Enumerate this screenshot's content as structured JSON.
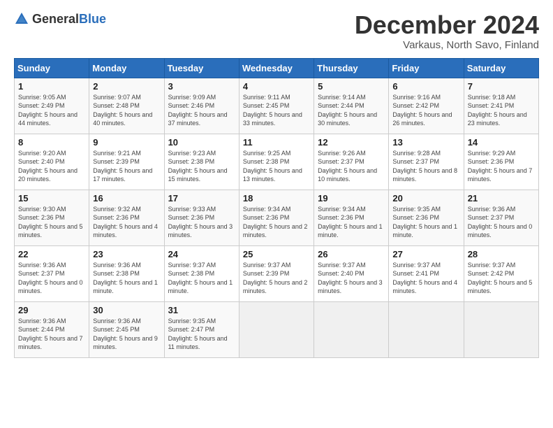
{
  "header": {
    "logo_general": "General",
    "logo_blue": "Blue",
    "title": "December 2024",
    "subtitle": "Varkaus, North Savo, Finland"
  },
  "weekdays": [
    "Sunday",
    "Monday",
    "Tuesday",
    "Wednesday",
    "Thursday",
    "Friday",
    "Saturday"
  ],
  "weeks": [
    [
      {
        "day": "1",
        "sunrise": "9:05 AM",
        "sunset": "2:49 PM",
        "daylight": "5 hours and 44 minutes."
      },
      {
        "day": "2",
        "sunrise": "9:07 AM",
        "sunset": "2:48 PM",
        "daylight": "5 hours and 40 minutes."
      },
      {
        "day": "3",
        "sunrise": "9:09 AM",
        "sunset": "2:46 PM",
        "daylight": "5 hours and 37 minutes."
      },
      {
        "day": "4",
        "sunrise": "9:11 AM",
        "sunset": "2:45 PM",
        "daylight": "5 hours and 33 minutes."
      },
      {
        "day": "5",
        "sunrise": "9:14 AM",
        "sunset": "2:44 PM",
        "daylight": "5 hours and 30 minutes."
      },
      {
        "day": "6",
        "sunrise": "9:16 AM",
        "sunset": "2:42 PM",
        "daylight": "5 hours and 26 minutes."
      },
      {
        "day": "7",
        "sunrise": "9:18 AM",
        "sunset": "2:41 PM",
        "daylight": "5 hours and 23 minutes."
      }
    ],
    [
      {
        "day": "8",
        "sunrise": "9:20 AM",
        "sunset": "2:40 PM",
        "daylight": "5 hours and 20 minutes."
      },
      {
        "day": "9",
        "sunrise": "9:21 AM",
        "sunset": "2:39 PM",
        "daylight": "5 hours and 17 minutes."
      },
      {
        "day": "10",
        "sunrise": "9:23 AM",
        "sunset": "2:38 PM",
        "daylight": "5 hours and 15 minutes."
      },
      {
        "day": "11",
        "sunrise": "9:25 AM",
        "sunset": "2:38 PM",
        "daylight": "5 hours and 13 minutes."
      },
      {
        "day": "12",
        "sunrise": "9:26 AM",
        "sunset": "2:37 PM",
        "daylight": "5 hours and 10 minutes."
      },
      {
        "day": "13",
        "sunrise": "9:28 AM",
        "sunset": "2:37 PM",
        "daylight": "5 hours and 8 minutes."
      },
      {
        "day": "14",
        "sunrise": "9:29 AM",
        "sunset": "2:36 PM",
        "daylight": "5 hours and 7 minutes."
      }
    ],
    [
      {
        "day": "15",
        "sunrise": "9:30 AM",
        "sunset": "2:36 PM",
        "daylight": "5 hours and 5 minutes."
      },
      {
        "day": "16",
        "sunrise": "9:32 AM",
        "sunset": "2:36 PM",
        "daylight": "5 hours and 4 minutes."
      },
      {
        "day": "17",
        "sunrise": "9:33 AM",
        "sunset": "2:36 PM",
        "daylight": "5 hours and 3 minutes."
      },
      {
        "day": "18",
        "sunrise": "9:34 AM",
        "sunset": "2:36 PM",
        "daylight": "5 hours and 2 minutes."
      },
      {
        "day": "19",
        "sunrise": "9:34 AM",
        "sunset": "2:36 PM",
        "daylight": "5 hours and 1 minute."
      },
      {
        "day": "20",
        "sunrise": "9:35 AM",
        "sunset": "2:36 PM",
        "daylight": "5 hours and 1 minute."
      },
      {
        "day": "21",
        "sunrise": "9:36 AM",
        "sunset": "2:37 PM",
        "daylight": "5 hours and 0 minutes."
      }
    ],
    [
      {
        "day": "22",
        "sunrise": "9:36 AM",
        "sunset": "2:37 PM",
        "daylight": "5 hours and 0 minutes."
      },
      {
        "day": "23",
        "sunrise": "9:36 AM",
        "sunset": "2:38 PM",
        "daylight": "5 hours and 1 minute."
      },
      {
        "day": "24",
        "sunrise": "9:37 AM",
        "sunset": "2:38 PM",
        "daylight": "5 hours and 1 minute."
      },
      {
        "day": "25",
        "sunrise": "9:37 AM",
        "sunset": "2:39 PM",
        "daylight": "5 hours and 2 minutes."
      },
      {
        "day": "26",
        "sunrise": "9:37 AM",
        "sunset": "2:40 PM",
        "daylight": "5 hours and 3 minutes."
      },
      {
        "day": "27",
        "sunrise": "9:37 AM",
        "sunset": "2:41 PM",
        "daylight": "5 hours and 4 minutes."
      },
      {
        "day": "28",
        "sunrise": "9:37 AM",
        "sunset": "2:42 PM",
        "daylight": "5 hours and 5 minutes."
      }
    ],
    [
      {
        "day": "29",
        "sunrise": "9:36 AM",
        "sunset": "2:44 PM",
        "daylight": "5 hours and 7 minutes."
      },
      {
        "day": "30",
        "sunrise": "9:36 AM",
        "sunset": "2:45 PM",
        "daylight": "5 hours and 9 minutes."
      },
      {
        "day": "31",
        "sunrise": "9:35 AM",
        "sunset": "2:47 PM",
        "daylight": "5 hours and 11 minutes."
      },
      null,
      null,
      null,
      null
    ]
  ],
  "labels": {
    "sunrise": "Sunrise:",
    "sunset": "Sunset:",
    "daylight": "Daylight:"
  }
}
